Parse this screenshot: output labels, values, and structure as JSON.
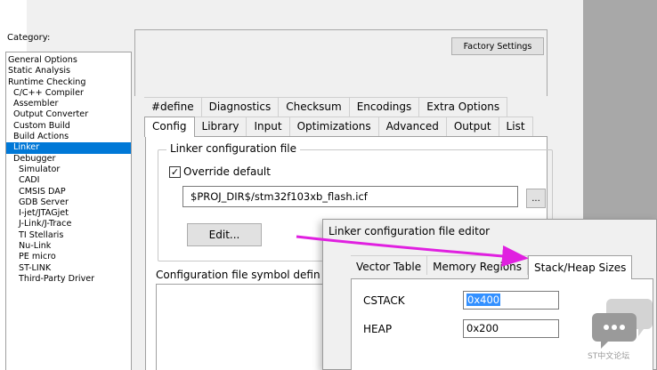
{
  "sidebar": {
    "category_label": "Category:",
    "items": [
      {
        "label": "General Options",
        "level": 0
      },
      {
        "label": "Static Analysis",
        "level": 0
      },
      {
        "label": "Runtime Checking",
        "level": 0
      },
      {
        "label": "C/C++ Compiler",
        "level": 1
      },
      {
        "label": "Assembler",
        "level": 1
      },
      {
        "label": "Output Converter",
        "level": 1
      },
      {
        "label": "Custom Build",
        "level": 1
      },
      {
        "label": "Build Actions",
        "level": 1
      },
      {
        "label": "Linker",
        "level": 1,
        "selected": true
      },
      {
        "label": "Debugger",
        "level": 1
      },
      {
        "label": "Simulator",
        "level": 2
      },
      {
        "label": "CADI",
        "level": 2
      },
      {
        "label": "CMSIS DAP",
        "level": 2
      },
      {
        "label": "GDB Server",
        "level": 2
      },
      {
        "label": "I-jet/JTAGjet",
        "level": 2
      },
      {
        "label": "J-Link/J-Trace",
        "level": 2
      },
      {
        "label": "TI Stellaris",
        "level": 2
      },
      {
        "label": "Nu-Link",
        "level": 2
      },
      {
        "label": "PE micro",
        "level": 2
      },
      {
        "label": "ST-LINK",
        "level": 2
      },
      {
        "label": "Third-Party Driver",
        "level": 2
      }
    ]
  },
  "factory_settings_label": "Factory Settings",
  "tabs_top": [
    "#define",
    "Diagnostics",
    "Checksum",
    "Encodings",
    "Extra Options"
  ],
  "tabs_bottom": [
    "Config",
    "Library",
    "Input",
    "Optimizations",
    "Advanced",
    "Output",
    "List"
  ],
  "active_tab": "Config",
  "linker_config": {
    "group_title": "Linker configuration file",
    "override_label": "Override default",
    "override_checked": true,
    "file_path": "$PROJ_DIR$/stm32f103xb_flash.icf",
    "browse_label": "...",
    "edit_label": "Edit..."
  },
  "symbol_section_label": "Configuration file symbol defin",
  "editor": {
    "title": "Linker configuration file editor",
    "tabs": [
      "Vector Table",
      "Memory Regions",
      "Stack/Heap Sizes"
    ],
    "active_tab": "Stack/Heap Sizes",
    "cstack_label": "CSTACK",
    "cstack_value": "0x400",
    "heap_label": "HEAP",
    "heap_value": "0x200"
  },
  "watermark_text": "ST中文论坛",
  "colors": {
    "selection": "#0078d7",
    "annotation_arrow": "#e020e0",
    "text_highlight": "#3390ff"
  }
}
